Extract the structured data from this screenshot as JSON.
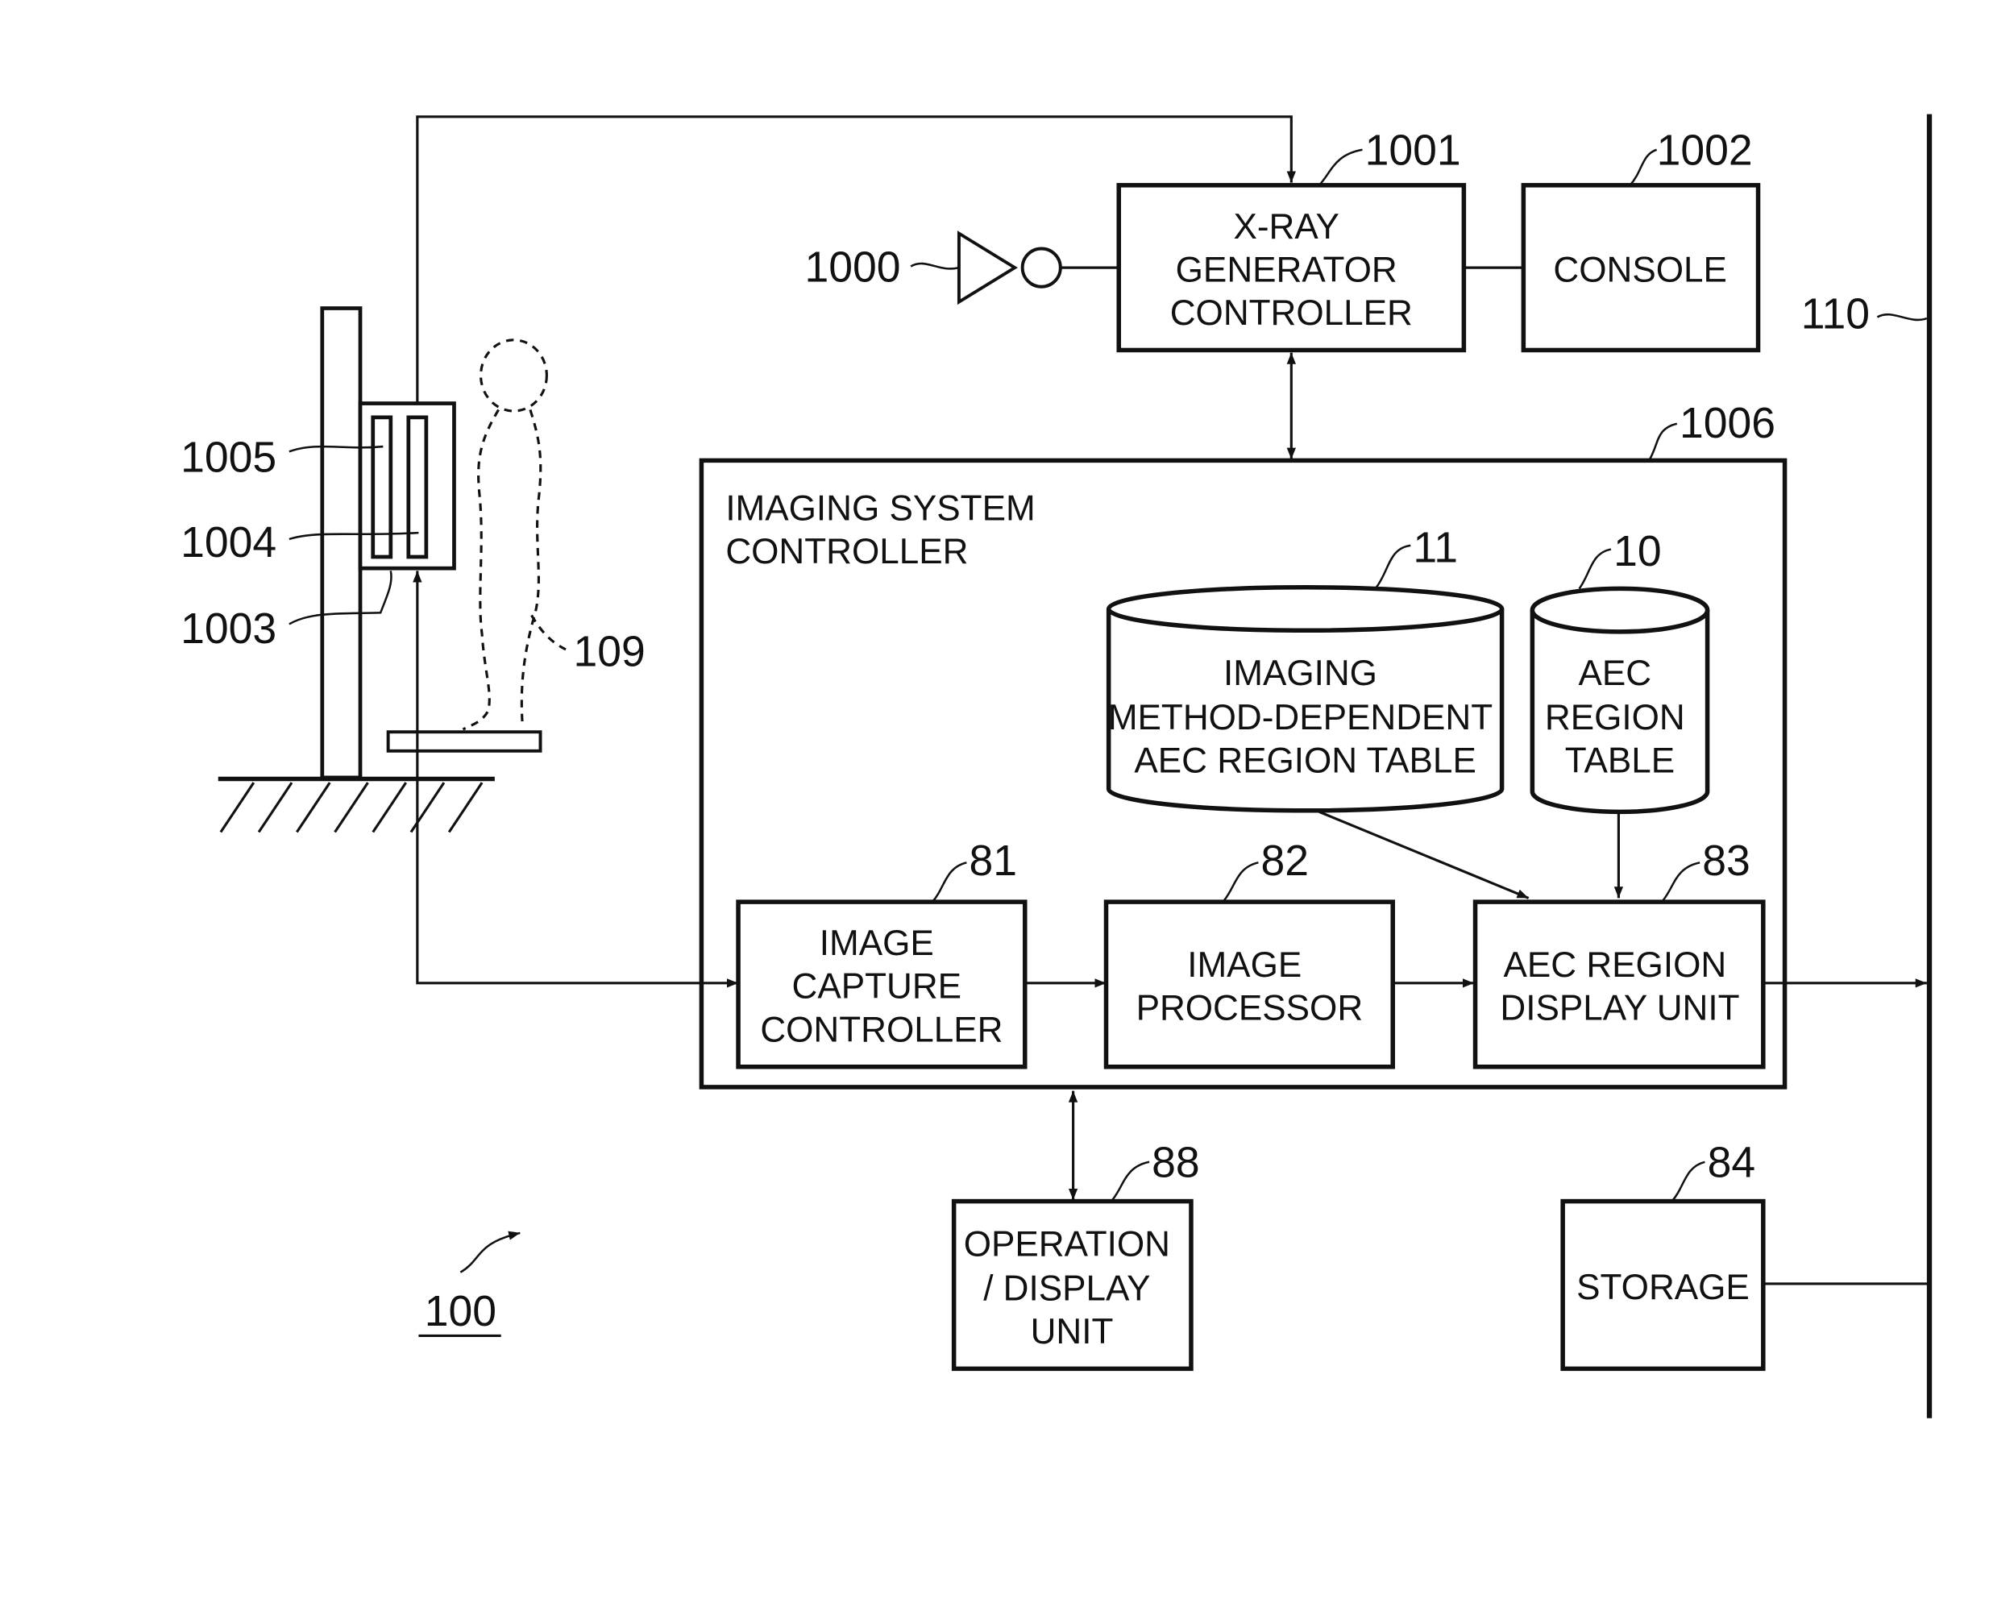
{
  "figure": {
    "ref_number": "100",
    "blocks": {
      "xray_generator_controller": {
        "ref": "1001",
        "lines": [
          "X-RAY",
          "GENERATOR",
          "CONTROLLER"
        ]
      },
      "console": {
        "ref": "1002",
        "lines": [
          "CONSOLE"
        ]
      },
      "imaging_system_controller": {
        "ref": "1006",
        "lines": [
          "IMAGING SYSTEM",
          "CONTROLLER"
        ]
      },
      "imaging_method_table": {
        "ref": "11",
        "lines": [
          "IMAGING",
          "METHOD-DEPENDENT",
          "AEC REGION TABLE"
        ]
      },
      "aec_region_table": {
        "ref": "10",
        "lines": [
          "AEC",
          "REGION",
          "TABLE"
        ]
      },
      "image_capture_controller": {
        "ref": "81",
        "lines": [
          "IMAGE",
          "CAPTURE",
          "CONTROLLER"
        ]
      },
      "image_processor": {
        "ref": "82",
        "lines": [
          "IMAGE",
          "PROCESSOR"
        ]
      },
      "aec_region_display_unit": {
        "ref": "83",
        "lines": [
          "AEC REGION",
          "DISPLAY UNIT"
        ]
      },
      "operation_display_unit": {
        "ref": "88",
        "lines": [
          "OPERATION",
          "/ DISPLAY",
          "UNIT"
        ]
      },
      "storage": {
        "ref": "84",
        "lines": [
          "STORAGE"
        ]
      }
    },
    "refs": {
      "exposure_switch": "1000",
      "bus": "110",
      "sensor_1005": "1005",
      "sensor_1004": "1004",
      "detector_1003": "1003",
      "subject": "109"
    }
  }
}
